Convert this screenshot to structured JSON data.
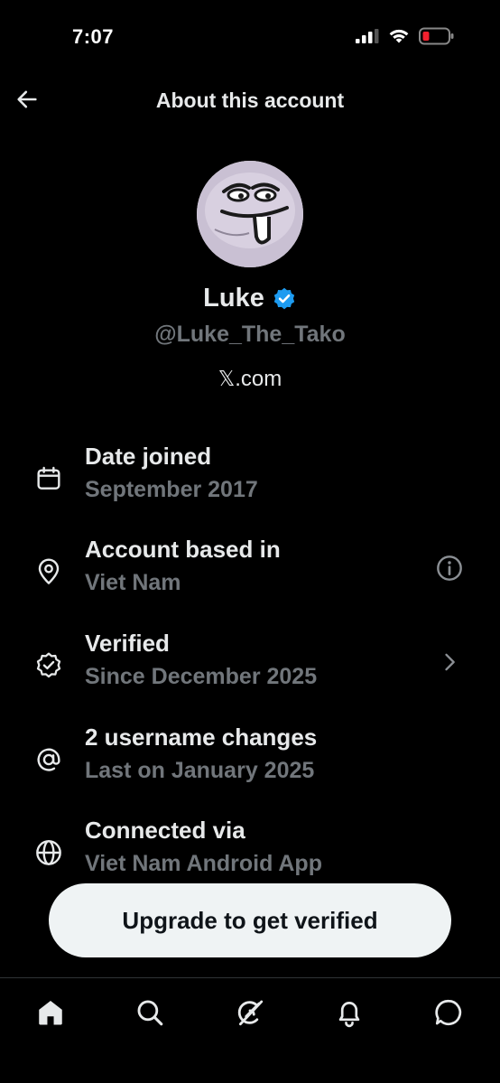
{
  "status_bar": {
    "time": "7:07"
  },
  "header": {
    "title": "About this account"
  },
  "profile": {
    "name": "Luke",
    "handle": "@Luke_The_Tako",
    "site_domain": ".com",
    "site_glyph": "𝕏"
  },
  "info_rows": [
    {
      "title": "Date joined",
      "subtitle": "September 2017",
      "icon": "calendar-icon"
    },
    {
      "title": "Account based in",
      "subtitle": "Viet Nam",
      "icon": "location-pin-icon",
      "trailing": "info-icon"
    },
    {
      "title": "Verified",
      "subtitle": "Since December 2025",
      "icon": "verified-badge-icon",
      "trailing": "chevron-right-icon"
    },
    {
      "title": "2 username changes",
      "subtitle": "Last on January 2025",
      "icon": "at-sign-icon"
    },
    {
      "title": "Connected via",
      "subtitle": "Viet Nam Android App",
      "icon": "globe-icon"
    }
  ],
  "upgrade_button": {
    "label": "Upgrade to get verified"
  },
  "tab_bar": [
    "home-icon",
    "search-icon",
    "grok-icon",
    "notifications-icon",
    "messages-icon"
  ],
  "colors": {
    "verified_blue": "#1d9bf0",
    "battery_red": "#f4212e",
    "secondary_text": "#71767b"
  }
}
